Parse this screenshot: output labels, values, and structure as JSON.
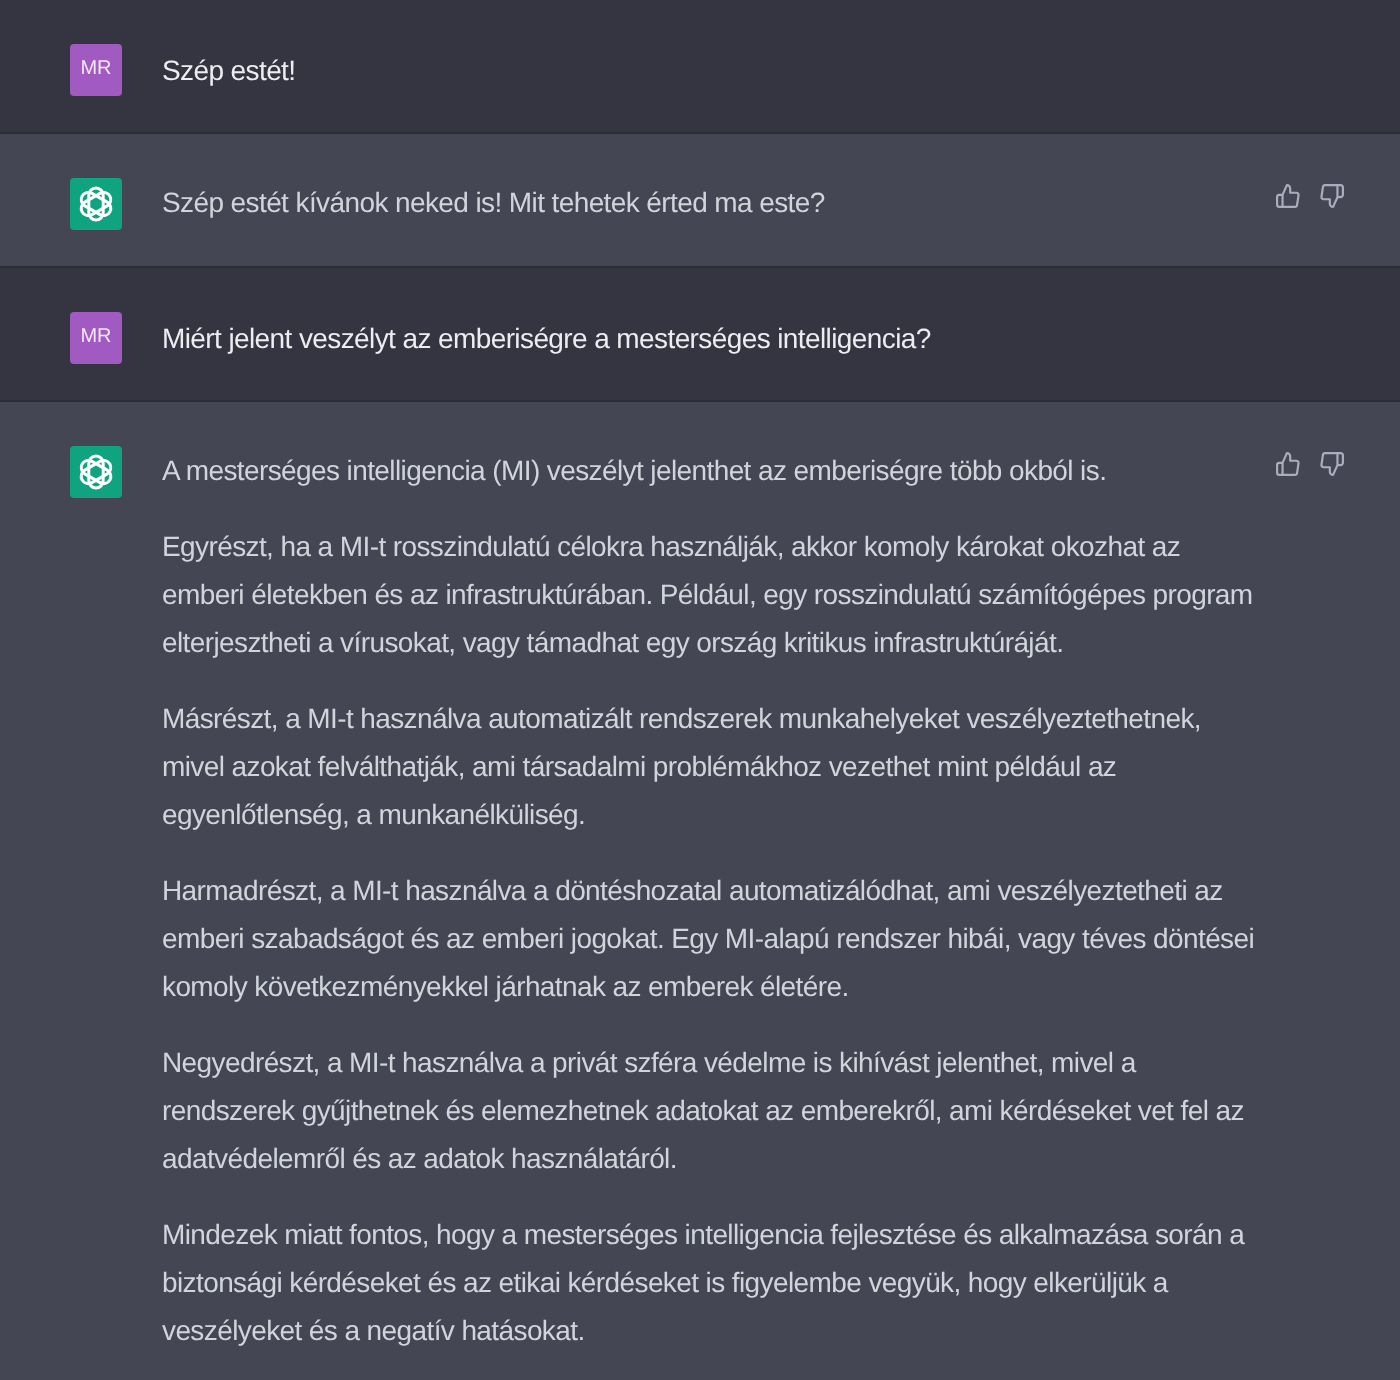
{
  "messages": [
    {
      "kind": "user",
      "avatar": {
        "initials": "MR"
      },
      "paragraphs": [
        "Szép estét!"
      ]
    },
    {
      "kind": "assistant",
      "paragraphs": [
        "Szép estét kívánok neked is! Mit tehetek érted ma este?"
      ]
    },
    {
      "kind": "user",
      "avatar": {
        "initials": "MR"
      },
      "paragraphs": [
        "Miért jelent veszélyt az emberiségre a mesterséges intelligencia?"
      ]
    },
    {
      "kind": "assistant",
      "paragraphs": [
        "A mesterséges intelligencia (MI) veszélyt jelenthet az emberiségre több okból is.",
        "Egyrészt, ha a MI-t rosszindulatú célokra használják, akkor komoly károkat okozhat az emberi életekben és az infrastruktúrában. Például, egy rosszindulatú számítógépes program elterjesztheti a vírusokat, vagy támadhat egy ország kritikus infrastruktúráját.",
        "Másrészt, a MI-t használva automatizált rendszerek munkahelyeket veszélyeztethetnek, mivel azokat felválthatják, ami társadalmi problémákhoz vezethet mint például az egyenlőtlenség, a munkanélküliség.",
        "Harmadrészt, a MI-t használva a döntéshozatal automatizálódhat, ami veszélyeztetheti az emberi szabadságot és az emberi jogokat. Egy MI-alapú rendszer hibái, vagy téves döntései komoly következményekkel járhatnak az emberek életére.",
        "Negyedrészt, a MI-t használva a privát szféra védelme is kihívást jelenthet, mivel a rendszerek gyűjthetnek és elemezhetnek adatokat az emberekről, ami kérdéseket vet fel az adatvédelemről és az adatok használatáról.",
        "Mindezek miatt fontos, hogy a mesterséges intelligencia fejlesztése és alkalmazása során a biztonsági kérdéseket és az etikai kérdéseket is figyelembe vegyük, hogy elkerüljük a veszélyeket és a negatív hatásokat."
      ]
    }
  ]
}
